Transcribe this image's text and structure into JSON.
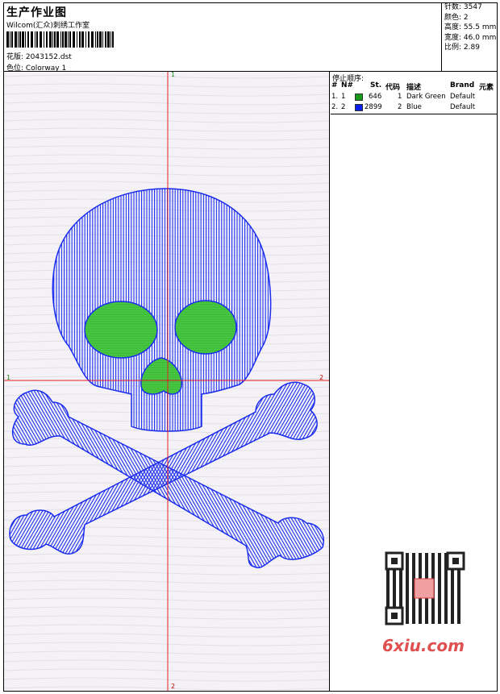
{
  "header": {
    "title": "生产作业图",
    "company": "Wilcom(汇众)刺绣工作室",
    "design_label": "花版:",
    "design_value": "2043152.dst",
    "colorway_label": "色位:",
    "colorway_value": "Colorway 1"
  },
  "stats": [
    {
      "label": "针数:",
      "value": "3547"
    },
    {
      "label": "颜色:",
      "value": "2"
    },
    {
      "label": "高度:",
      "value": "55.5 mm"
    },
    {
      "label": "宽度:",
      "value": "46.0 mm"
    },
    {
      "label": "比例:",
      "value": "2.89"
    }
  ],
  "canvas": {
    "axis_top": "1",
    "axis_left": "1",
    "axis_right": "2",
    "axis_bottom": "2"
  },
  "stop_sequence": {
    "title": "停止顺序:",
    "headers": {
      "num": "#",
      "n": "N#",
      "st": "St.",
      "code": "代码",
      "desc": "描述",
      "brand": "Brand",
      "elem": "元素"
    },
    "rows": [
      {
        "num": "1.",
        "n": "1",
        "color": "#1a9a1a",
        "st": "646",
        "code": "1",
        "desc": "Dark Green",
        "brand": "Default"
      },
      {
        "num": "2.",
        "n": "2",
        "color": "#0a1ee6",
        "st": "2899",
        "code": "2",
        "desc": "Blue",
        "brand": "Default"
      }
    ]
  },
  "watermark": {
    "text": "6xiu.com"
  },
  "colors": {
    "thread_blue": "#1a2cf0",
    "thread_green": "#3ec43a",
    "guide_red": "#e02020"
  }
}
